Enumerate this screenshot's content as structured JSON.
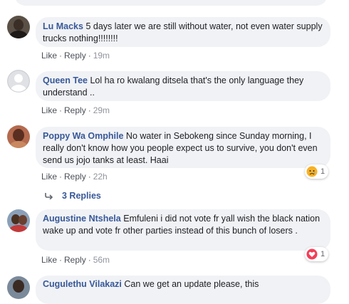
{
  "colors": {
    "name_link": "#385898",
    "bubble_bg": "#f0f2f5",
    "meta_text": "#65676b",
    "sad_reaction": "#f7b125",
    "love_reaction": "#f33e58"
  },
  "comments": [
    {
      "author": "Lu Macks",
      "text": "5 days later we are still without water, not even water supply trucks nothing!!!!!!!!",
      "like": "Like",
      "reply": "Reply",
      "time": "19m"
    },
    {
      "author": "Queen Tee",
      "text": "Lol ha ro kwalang ditsela that's the only language they understand ..",
      "like": "Like",
      "reply": "Reply",
      "time": "29m"
    },
    {
      "author": "Poppy Wa Omphile",
      "text": "No water in Sebokeng since Sunday morning, I really don't know how you people expect us to survive, you don't even send us jojo tanks at least. Haai",
      "like": "Like",
      "reply": "Reply",
      "time": "22h",
      "reaction": {
        "icon": "sad-reaction-icon",
        "count": "1"
      },
      "replies_label": "3 Replies"
    },
    {
      "author": "Augustine Ntshela",
      "text": "Emfuleni i did not vote fr yall wish the black nation wake up and vote fr other parties instead of this bunch of losers .",
      "like": "Like",
      "reply": "Reply",
      "time": "56m",
      "reaction": {
        "icon": "love-reaction-icon",
        "count": "1"
      }
    },
    {
      "author": "Cugulethu Vilakazi",
      "text": "Can we get an update please, this",
      "partial": true
    }
  ]
}
